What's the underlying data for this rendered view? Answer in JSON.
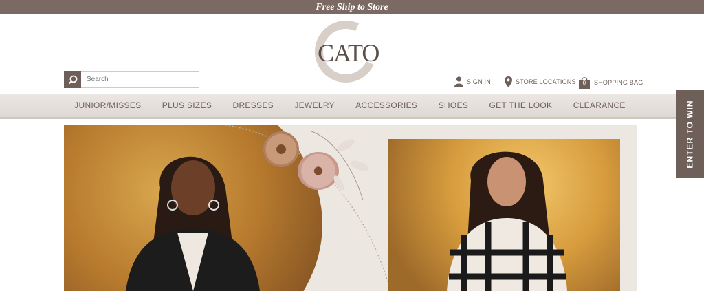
{
  "promo": {
    "text": "Free Ship to Store"
  },
  "logo": {
    "text": "CATO"
  },
  "search": {
    "placeholder": "Search"
  },
  "utility": {
    "sign_in": "SIGN IN",
    "store_locations": "STORE LOCATIONS",
    "bag_count": "0",
    "shopping_bag": "SHOPPING BAG"
  },
  "nav": {
    "items": [
      "JUNIOR/MISSES",
      "PLUS SIZES",
      "DRESSES",
      "JEWELRY",
      "ACCESSORIES",
      "SHOES",
      "GET THE LOOK",
      "CLEARANCE"
    ]
  },
  "side_tab": {
    "label": "ENTER TO WIN"
  },
  "colors": {
    "brand": "#6e5f59",
    "promo_bar": "#7a6a63",
    "nav_bg": "#e6e1dc"
  }
}
